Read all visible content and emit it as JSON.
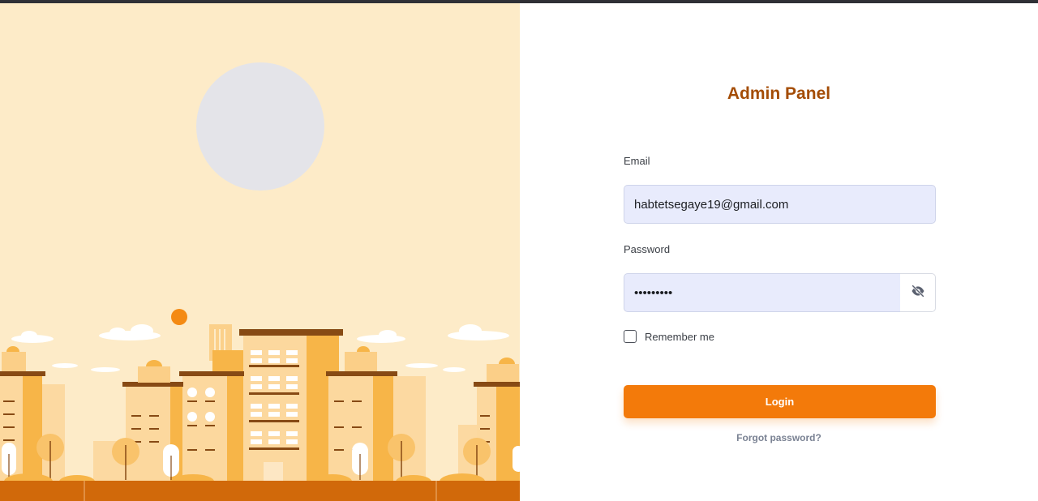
{
  "page": {
    "title": "Admin Panel"
  },
  "form": {
    "email_label": "Email",
    "email_value": "habtetsegaye19@gmail.com",
    "password_label": "Password",
    "password_masked": "•••••••••",
    "remember_label": "Remember me",
    "remember_checked": false,
    "login_label": "Login",
    "forgot_label": "Forgot password?"
  },
  "icons": {
    "password_toggle": "eye-off-icon"
  },
  "colors": {
    "accent": "#f37a0a",
    "title": "#a44d07",
    "input_bg": "#e8ebfc",
    "illustration_bg": "#fdebc8"
  }
}
